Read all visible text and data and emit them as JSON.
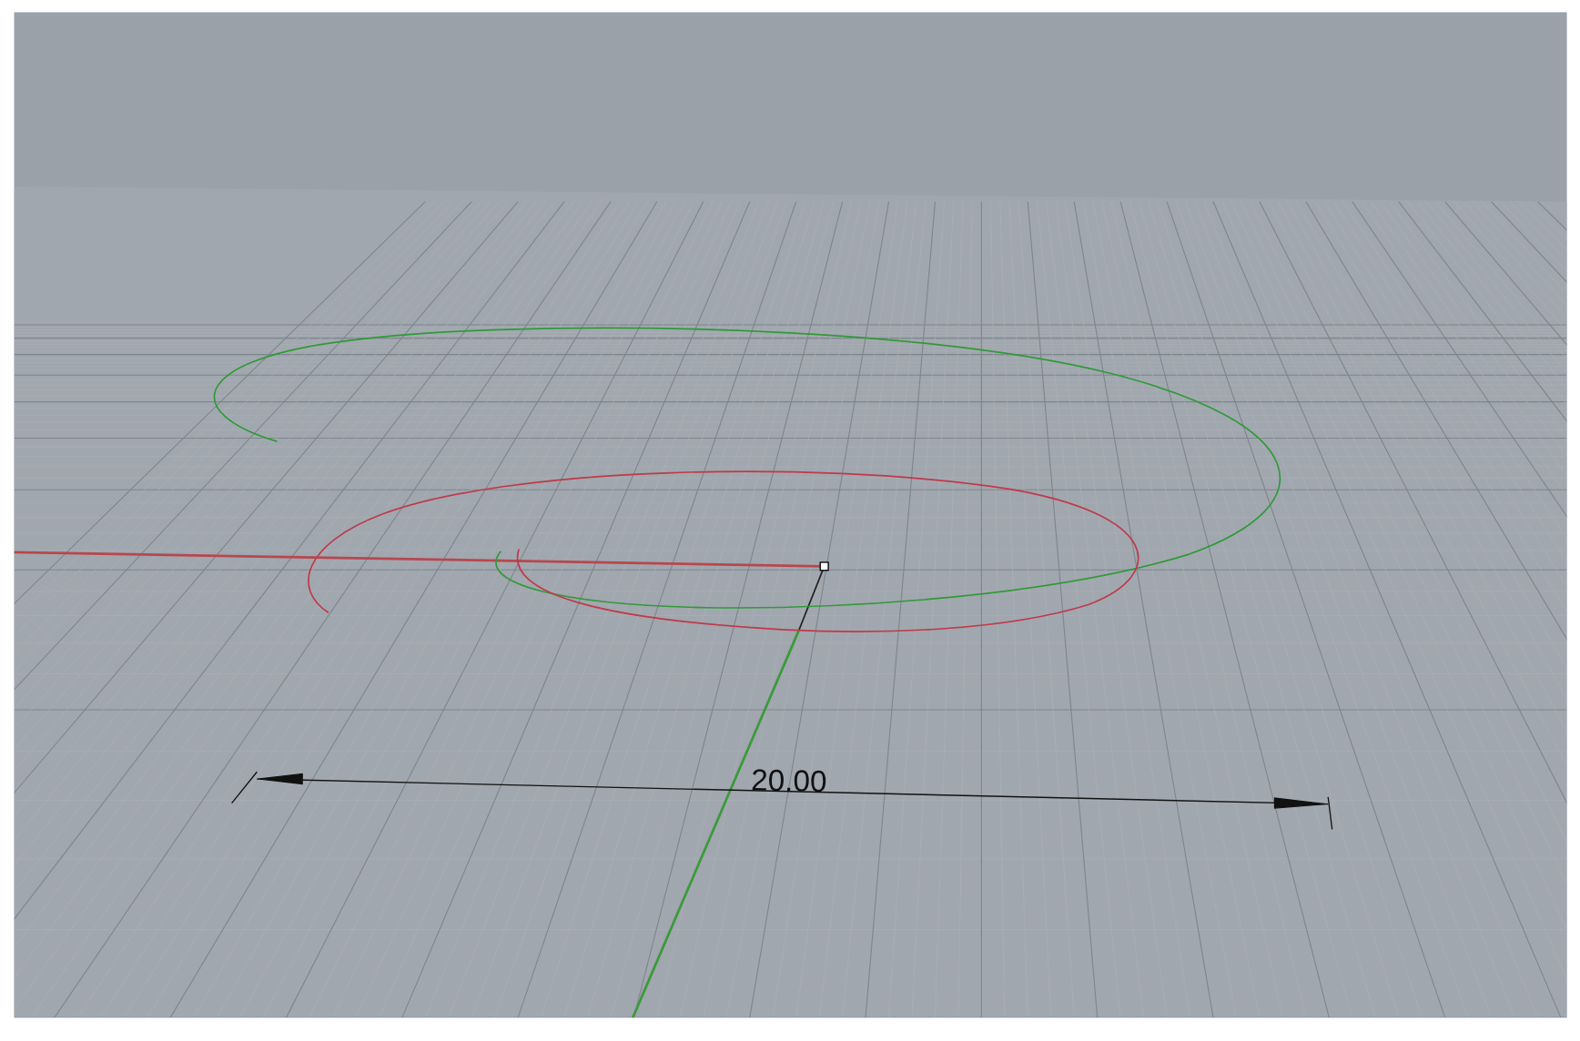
{
  "viewport": {
    "dimension": {
      "label": "20.00"
    }
  }
}
